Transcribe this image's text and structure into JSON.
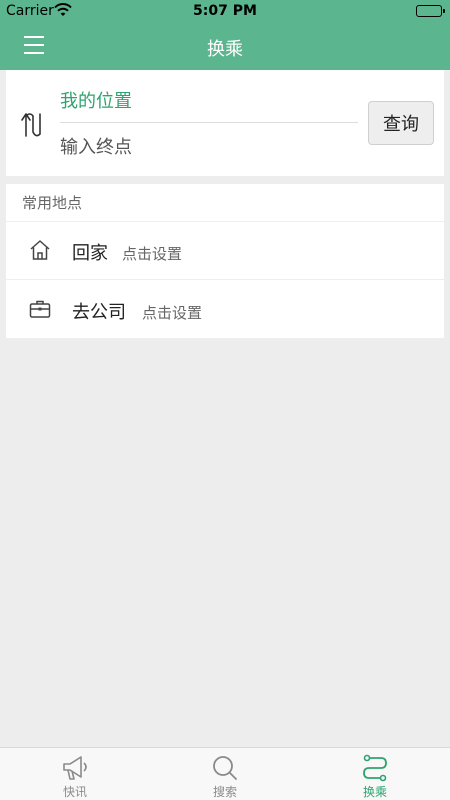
{
  "status_bar": {
    "carrier": "Carrier",
    "time": "5:07 PM",
    "icons": [
      "wifi-icon",
      "battery-icon"
    ]
  },
  "nav": {
    "title": "换乘",
    "menu_icon": "menu-icon"
  },
  "route": {
    "origin": "我的位置",
    "destination_placeholder": "输入终点",
    "query_label": "查询",
    "swap_icon": "swap-icon"
  },
  "places": {
    "header": "常用地点",
    "items": [
      {
        "name": "回家",
        "hint": "点击设置",
        "icon": "home-icon"
      },
      {
        "name": "去公司",
        "hint": "点击设置",
        "icon": "briefcase-icon"
      }
    ]
  },
  "tabs": [
    {
      "label": "快讯",
      "icon": "megaphone-icon",
      "active": false
    },
    {
      "label": "搜索",
      "icon": "search-icon",
      "active": false
    },
    {
      "label": "换乘",
      "icon": "transfer-icon",
      "active": true
    }
  ],
  "colors": {
    "brand": "#5bb58e",
    "accent": "#2fa36f",
    "background": "#ededed"
  }
}
